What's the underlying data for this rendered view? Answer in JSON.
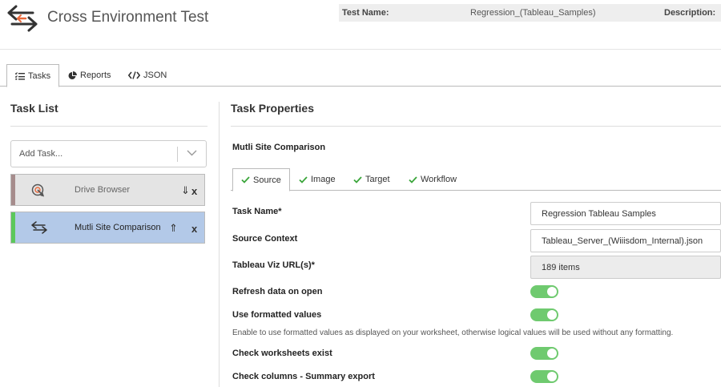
{
  "header": {
    "title": "Cross Environment Test",
    "test_name_label": "Test Name:",
    "test_name_value": "Regression_(Tableau_Samples)",
    "description_label": "Description:"
  },
  "tabs": [
    {
      "label": "Tasks",
      "icon": "list-check-icon",
      "active": true
    },
    {
      "label": "Reports",
      "icon": "pie-chart-icon",
      "active": false
    },
    {
      "label": "JSON",
      "icon": "code-icon",
      "active": false
    }
  ],
  "task_list": {
    "title": "Task List",
    "add_placeholder": "Add Task...",
    "items": [
      {
        "label": "Drive Browser",
        "icon": "target-cursor-icon",
        "bar_color": "#a68c8c",
        "selected": false
      },
      {
        "label": "Mutli Site Comparison",
        "icon": "swap-arrows-icon",
        "bar_color": "#5cc85c",
        "selected": true
      }
    ]
  },
  "properties": {
    "title": "Task Properties",
    "task_title": "Mutli Site Comparison",
    "subtabs": [
      {
        "label": "Source",
        "icon": "check-icon",
        "active": true
      },
      {
        "label": "Image",
        "icon": "check-icon",
        "active": false
      },
      {
        "label": "Target",
        "icon": "check-icon",
        "active": false
      },
      {
        "label": "Workflow",
        "icon": "check-icon",
        "active": false
      }
    ],
    "task_name_label": "Task Name*",
    "task_name_value": "Regression Tableau Samples",
    "source_context_label": "Source Context",
    "source_context_value": "Tableau_Server_(Wiiisdom_Internal).json",
    "viz_urls_label": "Tableau Viz URL(s)*",
    "viz_urls_value": "189 items",
    "refresh_label": "Refresh data on open",
    "refresh_on": true,
    "formatted_label": "Use formatted values",
    "formatted_on": true,
    "formatted_hint": "Enable to use formatted values as displayed on your worksheet, otherwise logical values will be used without any formatting.",
    "worksheets_label": "Check worksheets exist",
    "worksheets_on": true,
    "columns_label": "Check columns - Summary export",
    "columns_on": true
  },
  "colors": {
    "accent_green": "#3aa53a",
    "toggle_on": "#6fca6f",
    "selected_task_bg": "#b3c9e8",
    "unselected_task_bg": "#e4e4e4",
    "logo_orange": "#e8683a"
  }
}
